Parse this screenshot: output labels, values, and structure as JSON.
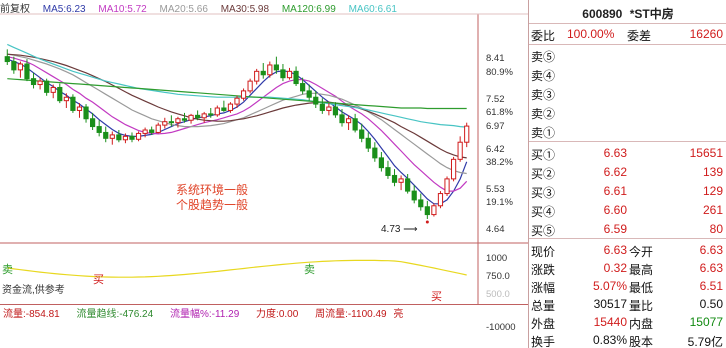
{
  "chart": {
    "adjust_label": "前复权",
    "ma_indicators": [
      {
        "label": "MA5:6.23",
        "color": "#2f3aa8"
      },
      {
        "label": "MA10:5.72",
        "color": "#c23ac2"
      },
      {
        "label": "MA20:5.66",
        "color": "#9a9a9a"
      },
      {
        "label": "MA30:5.98",
        "color": "#6b3a3a"
      },
      {
        "label": "MA120:6.99",
        "color": "#2e9c2e"
      },
      {
        "label": "MA60:6.61",
        "color": "#48c4c4"
      }
    ],
    "price_ticks": [
      "8.41",
      "80.9%",
      "7.52",
      "61.8%",
      "6.97",
      "6.42",
      "38.2%",
      "5.53",
      "19.1%",
      "4.64"
    ],
    "annotation_lines": [
      "系统环境一般",
      "个股趋势一般"
    ],
    "low_marker": "4.73",
    "indicator_ticks": [
      "1000",
      "750.0",
      "500.0"
    ],
    "signals": {
      "buy": "买",
      "sell": "卖"
    },
    "indicator_name": "资金流,供参考",
    "flow_bar": [
      {
        "label": "流量:-854.81",
        "color": "#c01818"
      },
      {
        "label": "流量趋线:-476.24",
        "color": "#2e8a2e"
      },
      {
        "label": "流量幅%:-11.29",
        "color": "#b020b0"
      },
      {
        "label": "力度:0.00",
        "color": "#c01818"
      },
      {
        "label": "周流量:-1100.49",
        "color": "#c01818"
      },
      {
        "label": "亮",
        "color": "#c01818"
      }
    ],
    "flow_ticks": [
      "-10000"
    ]
  },
  "quote": {
    "code": "600890",
    "name": "*ST中房",
    "weibi_label": "委比",
    "weibi_value": "100.00%",
    "weicha_label": "委差",
    "weicha_value": "16260",
    "asks": [
      {
        "label": "卖⑤",
        "price": "",
        "volume": ""
      },
      {
        "label": "卖④",
        "price": "",
        "volume": ""
      },
      {
        "label": "卖③",
        "price": "",
        "volume": ""
      },
      {
        "label": "卖②",
        "price": "",
        "volume": ""
      },
      {
        "label": "卖①",
        "price": "",
        "volume": ""
      }
    ],
    "bids": [
      {
        "label": "买①",
        "price": "6.63",
        "volume": "15651"
      },
      {
        "label": "买②",
        "price": "6.62",
        "volume": "139"
      },
      {
        "label": "买③",
        "price": "6.61",
        "volume": "129"
      },
      {
        "label": "买④",
        "price": "6.60",
        "volume": "261"
      },
      {
        "label": "买⑤",
        "price": "6.59",
        "volume": "80"
      }
    ],
    "stats": [
      {
        "l1": "现价",
        "v1": "6.63",
        "c1": "red",
        "l2": "今开",
        "v2": "6.63",
        "c2": "red"
      },
      {
        "l1": "涨跌",
        "v1": "0.32",
        "c1": "red",
        "l2": "最高",
        "v2": "6.63",
        "c2": "red"
      },
      {
        "l1": "涨幅",
        "v1": "5.07%",
        "c1": "red",
        "l2": "最低",
        "v2": "6.51",
        "c2": "red"
      },
      {
        "l1": "总量",
        "v1": "30517",
        "c1": "blk",
        "l2": "量比",
        "v2": "0.50",
        "c2": "blk"
      },
      {
        "l1": "外盘",
        "v1": "15440",
        "c1": "red",
        "l2": "内盘",
        "v2": "15077",
        "c2": "green"
      },
      {
        "l1": "换手",
        "v1": "0.83%",
        "c1": "blk",
        "l2": "股本",
        "v2": "5.79亿",
        "c2": "blk"
      }
    ]
  },
  "chart_data": {
    "type": "candlestick",
    "title": "",
    "ylim": [
      4.3,
      8.8
    ],
    "candles_ohlc": [
      [
        8.05,
        8.2,
        7.88,
        7.95
      ],
      [
        7.95,
        8.05,
        7.7,
        7.78
      ],
      [
        7.78,
        7.95,
        7.62,
        7.9
      ],
      [
        7.9,
        8.0,
        7.55,
        7.6
      ],
      [
        7.6,
        7.72,
        7.4,
        7.48
      ],
      [
        7.48,
        7.62,
        7.38,
        7.55
      ],
      [
        7.55,
        7.6,
        7.25,
        7.32
      ],
      [
        7.32,
        7.48,
        7.2,
        7.42
      ],
      [
        7.42,
        7.5,
        7.1,
        7.15
      ],
      [
        7.15,
        7.3,
        7.0,
        7.22
      ],
      [
        7.22,
        7.28,
        6.9,
        6.95
      ],
      [
        6.95,
        7.1,
        6.8,
        7.02
      ],
      [
        7.02,
        7.08,
        6.7,
        6.78
      ],
      [
        6.78,
        6.9,
        6.55,
        6.62
      ],
      [
        6.62,
        6.75,
        6.42,
        6.5
      ],
      [
        6.5,
        6.62,
        6.3,
        6.38
      ],
      [
        6.38,
        6.52,
        6.25,
        6.45
      ],
      [
        6.45,
        6.55,
        6.3,
        6.35
      ],
      [
        6.35,
        6.48,
        6.28,
        6.42
      ],
      [
        6.42,
        6.5,
        6.3,
        6.36
      ],
      [
        6.36,
        6.52,
        6.32,
        6.48
      ],
      [
        6.48,
        6.6,
        6.4,
        6.55
      ],
      [
        6.55,
        6.62,
        6.45,
        6.5
      ],
      [
        6.5,
        6.7,
        6.48,
        6.65
      ],
      [
        6.65,
        6.8,
        6.58,
        6.72
      ],
      [
        6.72,
        6.85,
        6.62,
        6.7
      ],
      [
        6.7,
        6.82,
        6.6,
        6.78
      ],
      [
        6.78,
        6.9,
        6.7,
        6.75
      ],
      [
        6.75,
        6.88,
        6.68,
        6.85
      ],
      [
        6.85,
        6.95,
        6.75,
        6.8
      ],
      [
        6.8,
        6.92,
        6.7,
        6.88
      ],
      [
        6.88,
        7.0,
        6.8,
        6.86
      ],
      [
        6.86,
        7.05,
        6.82,
        7.0
      ],
      [
        7.0,
        7.15,
        6.92,
        6.95
      ],
      [
        6.95,
        7.12,
        6.9,
        7.08
      ],
      [
        7.08,
        7.25,
        7.0,
        7.2
      ],
      [
        7.2,
        7.4,
        7.15,
        7.35
      ],
      [
        7.35,
        7.6,
        7.3,
        7.55
      ],
      [
        7.55,
        7.8,
        7.48,
        7.75
      ],
      [
        7.75,
        7.92,
        7.6,
        7.68
      ],
      [
        7.68,
        7.95,
        7.62,
        7.88
      ],
      [
        7.88,
        8.05,
        7.7,
        7.78
      ],
      [
        7.78,
        7.9,
        7.55,
        7.62
      ],
      [
        7.62,
        7.82,
        7.58,
        7.75
      ],
      [
        7.75,
        7.85,
        7.45,
        7.5
      ],
      [
        7.5,
        7.62,
        7.28,
        7.35
      ],
      [
        7.35,
        7.48,
        7.15,
        7.22
      ],
      [
        7.22,
        7.35,
        7.0,
        7.08
      ],
      [
        7.08,
        7.2,
        6.88,
        6.95
      ],
      [
        6.95,
        7.1,
        6.85,
        7.02
      ],
      [
        7.02,
        7.12,
        6.8,
        6.86
      ],
      [
        6.86,
        6.98,
        6.62,
        6.7
      ],
      [
        6.7,
        6.85,
        6.55,
        6.78
      ],
      [
        6.78,
        6.88,
        6.5,
        6.55
      ],
      [
        6.55,
        6.68,
        6.3,
        6.38
      ],
      [
        6.38,
        6.5,
        6.1,
        6.18
      ],
      [
        6.18,
        6.3,
        5.9,
        5.98
      ],
      [
        5.98,
        6.1,
        5.7,
        5.78
      ],
      [
        5.78,
        5.92,
        5.55,
        5.62
      ],
      [
        5.62,
        5.75,
        5.4,
        5.48
      ],
      [
        5.48,
        5.62,
        5.32,
        5.55
      ],
      [
        5.55,
        5.65,
        5.25,
        5.3
      ],
      [
        5.3,
        5.42,
        5.05,
        5.12
      ],
      [
        5.12,
        5.25,
        4.9,
        4.98
      ],
      [
        4.98,
        5.1,
        4.73,
        4.82
      ],
      [
        4.82,
        5.05,
        4.78,
        5.0
      ],
      [
        5.0,
        5.3,
        4.95,
        5.25
      ],
      [
        5.25,
        5.6,
        5.2,
        5.55
      ],
      [
        5.55,
        6.0,
        5.5,
        5.95
      ],
      [
        5.95,
        6.42,
        5.9,
        6.3
      ],
      [
        6.3,
        6.7,
        6.2,
        6.63
      ]
    ],
    "ma_lines": [
      {
        "name": "MA5",
        "color": "#2f3aa8",
        "values": [
          8.0,
          7.95,
          7.9,
          7.82,
          7.72,
          7.62,
          7.52,
          7.44,
          7.34,
          7.26,
          7.16,
          7.08,
          6.98,
          6.88,
          6.76,
          6.66,
          6.56,
          6.48,
          6.44,
          6.42,
          6.42,
          6.44,
          6.46,
          6.5,
          6.56,
          6.62,
          6.68,
          6.72,
          6.76,
          6.8,
          6.82,
          6.84,
          6.88,
          6.9,
          6.95,
          7.02,
          7.12,
          7.26,
          7.4,
          7.54,
          7.66,
          7.74,
          7.76,
          7.74,
          7.68,
          7.58,
          7.46,
          7.34,
          7.22,
          7.12,
          7.02,
          6.92,
          6.84,
          6.76,
          6.66,
          6.52,
          6.36,
          6.18,
          6.0,
          5.82,
          5.68,
          5.56,
          5.42,
          5.28,
          5.14,
          5.04,
          5.04,
          5.12,
          5.3,
          5.55,
          5.9
        ]
      },
      {
        "name": "MA10",
        "color": "#c23ac2",
        "values": [
          8.05,
          8.02,
          7.98,
          7.94,
          7.88,
          7.8,
          7.72,
          7.64,
          7.56,
          7.48,
          7.38,
          7.3,
          7.2,
          7.12,
          7.02,
          6.92,
          6.82,
          6.74,
          6.66,
          6.6,
          6.54,
          6.5,
          6.48,
          6.47,
          6.48,
          6.5,
          6.54,
          6.58,
          6.62,
          6.66,
          6.7,
          6.73,
          6.76,
          6.8,
          6.84,
          6.88,
          6.94,
          7.02,
          7.12,
          7.22,
          7.32,
          7.42,
          7.5,
          7.55,
          7.58,
          7.58,
          7.55,
          7.48,
          7.4,
          7.32,
          7.24,
          7.14,
          7.04,
          6.96,
          6.88,
          6.78,
          6.66,
          6.54,
          6.4,
          6.26,
          6.12,
          5.98,
          5.84,
          5.72,
          5.6,
          5.48,
          5.38,
          5.3,
          5.3,
          5.36,
          5.5
        ]
      },
      {
        "name": "MA20",
        "color": "#9a9a9a",
        "values": [
          8.1,
          8.08,
          8.05,
          8.02,
          7.98,
          7.94,
          7.9,
          7.85,
          7.8,
          7.74,
          7.68,
          7.6,
          7.52,
          7.44,
          7.36,
          7.28,
          7.2,
          7.12,
          7.04,
          6.96,
          6.9,
          6.84,
          6.78,
          6.74,
          6.7,
          6.66,
          6.64,
          6.62,
          6.62,
          6.62,
          6.63,
          6.64,
          6.66,
          6.68,
          6.72,
          6.76,
          6.8,
          6.86,
          6.92,
          6.98,
          7.04,
          7.1,
          7.16,
          7.2,
          7.24,
          7.28,
          7.3,
          7.3,
          7.28,
          7.26,
          7.22,
          7.18,
          7.12,
          7.06,
          7.0,
          6.92,
          6.84,
          6.76,
          6.66,
          6.56,
          6.46,
          6.36,
          6.26,
          6.16,
          6.06,
          5.96,
          5.86,
          5.78,
          5.72,
          5.68,
          5.66
        ]
      },
      {
        "name": "MA30",
        "color": "#6b3a3a",
        "values": [
          8.1,
          8.09,
          8.08,
          8.06,
          8.04,
          8.01,
          7.98,
          7.95,
          7.91,
          7.87,
          7.82,
          7.77,
          7.72,
          7.66,
          7.6,
          7.54,
          7.47,
          7.4,
          7.33,
          7.26,
          7.2,
          7.14,
          7.08,
          7.02,
          6.97,
          6.92,
          6.88,
          6.84,
          6.8,
          6.77,
          6.75,
          6.74,
          6.73,
          6.73,
          6.74,
          6.76,
          6.78,
          6.81,
          6.84,
          6.88,
          6.92,
          6.96,
          7.0,
          7.03,
          7.06,
          7.08,
          7.1,
          7.11,
          7.12,
          7.12,
          7.1,
          7.08,
          7.05,
          7.02,
          6.98,
          6.93,
          6.88,
          6.82,
          6.76,
          6.7,
          6.62,
          6.55,
          6.48,
          6.4,
          6.32,
          6.24,
          6.16,
          6.09,
          6.04,
          6.0,
          5.98
        ]
      },
      {
        "name": "MA60",
        "color": "#48c4c4",
        "values": [
          8.3,
          8.24,
          8.18,
          8.12,
          8.06,
          8.0,
          7.95,
          7.9,
          7.85,
          7.8,
          7.75,
          7.71,
          7.67,
          7.63,
          7.59,
          7.55,
          7.52,
          7.49,
          7.46,
          7.43,
          7.4,
          7.38,
          7.36,
          7.34,
          7.32,
          7.3,
          7.28,
          7.27,
          7.26,
          7.25,
          7.24,
          7.23,
          7.22,
          7.22,
          7.22,
          7.22,
          7.22,
          7.22,
          7.22,
          7.22,
          7.22,
          7.21,
          7.2,
          7.19,
          7.18,
          7.17,
          7.15,
          7.13,
          7.11,
          7.09,
          7.07,
          7.05,
          7.03,
          7.01,
          6.99,
          6.96,
          6.93,
          6.9,
          6.87,
          6.84,
          6.81,
          6.78,
          6.75,
          6.72,
          6.7,
          6.68,
          6.66,
          6.65,
          6.64,
          6.62,
          6.61
        ]
      },
      {
        "name": "MA120",
        "color": "#2e9c2e",
        "values": [
          7.6,
          7.59,
          7.58,
          7.57,
          7.56,
          7.55,
          7.54,
          7.53,
          7.52,
          7.51,
          7.5,
          7.49,
          7.48,
          7.47,
          7.46,
          7.45,
          7.44,
          7.43,
          7.42,
          7.41,
          7.4,
          7.39,
          7.38,
          7.37,
          7.36,
          7.35,
          7.34,
          7.33,
          7.32,
          7.31,
          7.3,
          7.29,
          7.28,
          7.27,
          7.26,
          7.25,
          7.24,
          7.23,
          7.22,
          7.21,
          7.2,
          7.19,
          7.18,
          7.17,
          7.16,
          7.15,
          7.14,
          7.13,
          7.12,
          7.11,
          7.1,
          7.09,
          7.08,
          7.07,
          7.06,
          7.05,
          7.04,
          7.03,
          7.02,
          7.01,
          7.0,
          7.0,
          7.0,
          7.0,
          6.99,
          6.99,
          6.99,
          6.99,
          6.99,
          6.99,
          6.99
        ]
      }
    ]
  }
}
